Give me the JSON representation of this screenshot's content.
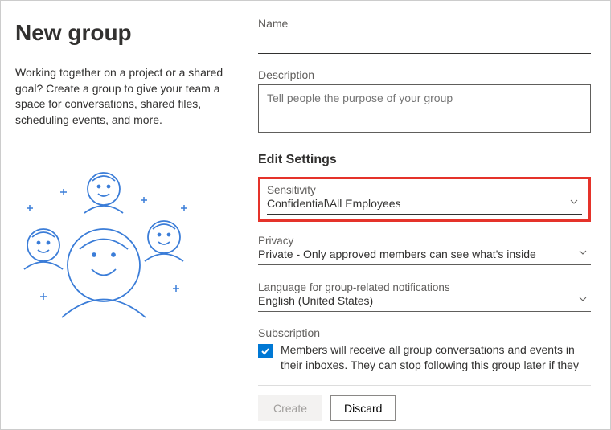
{
  "left": {
    "title": "New group",
    "intro": "Working together on a project or a shared goal? Create a group to give your team a space for conversations, shared files, scheduling events, and more."
  },
  "form": {
    "name_label": "Name",
    "name_value": "",
    "description_label": "Description",
    "description_placeholder": "Tell people the purpose of your group",
    "edit_settings_header": "Edit Settings",
    "sensitivity_label": "Sensitivity",
    "sensitivity_value": "Confidential\\All Employees",
    "privacy_label": "Privacy",
    "privacy_value": "Private - Only approved members can see what's inside",
    "language_label": "Language for group-related notifications",
    "language_value": "English (United States)",
    "subscription_label": "Subscription",
    "subscription_text": "Members will receive all group conversations and events in their inboxes. They can stop following this group later if they"
  },
  "footer": {
    "create_label": "Create",
    "discard_label": "Discard"
  }
}
